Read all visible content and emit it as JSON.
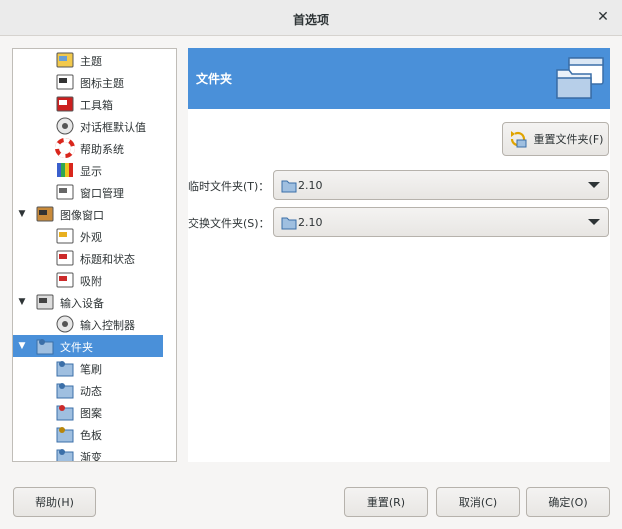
{
  "window": {
    "title": "首选项",
    "close_glyph": "✕"
  },
  "tree": {
    "items": [
      {
        "label": "主题",
        "icon": "theme-icon",
        "level": 2
      },
      {
        "label": "图标主题",
        "icon": "icon-theme-icon",
        "level": 2
      },
      {
        "label": "工具箱",
        "icon": "toolbox-icon",
        "level": 2
      },
      {
        "label": "对话框默认值",
        "icon": "dialog-defaults-icon",
        "level": 2
      },
      {
        "label": "帮助系统",
        "icon": "help-system-icon",
        "level": 2
      },
      {
        "label": "显示",
        "icon": "display-icon",
        "level": 2
      },
      {
        "label": "窗口管理",
        "icon": "window-management-icon",
        "level": 2
      },
      {
        "label": "图像窗口",
        "icon": "image-window-icon",
        "level": 1,
        "expanded": true
      },
      {
        "label": "外观",
        "icon": "appearance-icon",
        "level": 2
      },
      {
        "label": "标题和状态",
        "icon": "title-status-icon",
        "level": 2
      },
      {
        "label": "吸附",
        "icon": "snap-icon",
        "level": 2
      },
      {
        "label": "输入设备",
        "icon": "input-devices-icon",
        "level": 1,
        "expanded": true
      },
      {
        "label": "输入控制器",
        "icon": "input-controllers-icon",
        "level": 2
      },
      {
        "label": "文件夹",
        "icon": "folders-icon",
        "level": 1,
        "expanded": true,
        "selected": true
      },
      {
        "label": "笔刷",
        "icon": "brushes-folder-icon",
        "level": 2
      },
      {
        "label": "动态",
        "icon": "dynamics-folder-icon",
        "level": 2
      },
      {
        "label": "图案",
        "icon": "patterns-folder-icon",
        "level": 2
      },
      {
        "label": "色板",
        "icon": "palettes-folder-icon",
        "level": 2
      },
      {
        "label": "渐变",
        "icon": "gradients-folder-icon",
        "level": 2
      }
    ]
  },
  "panel": {
    "title": "文件夹",
    "reset_button": "重置文件夹(F)",
    "temp_folder": {
      "label": "临时文件夹(T)：",
      "value": "2.10"
    },
    "swap_folder": {
      "label": "交换文件夹(S)：",
      "value": "2.10"
    }
  },
  "footer": {
    "help": "帮助(H)",
    "reset": "重置(R)",
    "cancel": "取消(C)",
    "ok": "确定(O)"
  },
  "colors": {
    "accent": "#4a90d9",
    "folder": "#9fbfe0"
  }
}
